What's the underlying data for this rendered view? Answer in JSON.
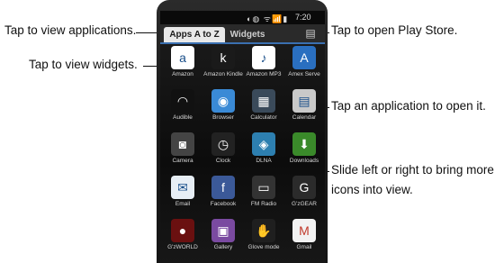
{
  "status_bar": {
    "icons_text": "◐◍ ᯤ📶▮",
    "time": "7:20"
  },
  "tabs": [
    {
      "label": "Apps A to Z"
    },
    {
      "label": "Widgets"
    }
  ],
  "store_icon": "play-store-icon",
  "apps": [
    {
      "label": "Amazon",
      "icon": "amazon-icon",
      "color": "#ffffff"
    },
    {
      "label": "Amazon Kindle",
      "icon": "kindle-icon",
      "color": "#1a1a1a"
    },
    {
      "label": "Amazon MP3",
      "icon": "amazon-mp3-icon",
      "color": "#ffffff"
    },
    {
      "label": "Amex Serve",
      "icon": "amex-icon",
      "color": "#2a6fc0"
    },
    {
      "label": "Audible",
      "icon": "audible-icon",
      "color": "#111111"
    },
    {
      "label": "Browser",
      "icon": "globe-icon",
      "color": "#3a8ad6"
    },
    {
      "label": "Calculator",
      "icon": "calculator-icon",
      "color": "#3a4a5a"
    },
    {
      "label": "Calendar",
      "icon": "calendar-icon",
      "color": "#c9c9c9"
    },
    {
      "label": "Camera",
      "icon": "camera-icon",
      "color": "#444444"
    },
    {
      "label": "Clock",
      "icon": "clock-icon",
      "color": "#222222"
    },
    {
      "label": "DLNA",
      "icon": "dlna-icon",
      "color": "#2d7fb0"
    },
    {
      "label": "Downloads",
      "icon": "download-icon",
      "color": "#3a8a2a"
    },
    {
      "label": "Email",
      "icon": "email-icon",
      "color": "#e7eef5"
    },
    {
      "label": "Facebook",
      "icon": "facebook-icon",
      "color": "#3b5998"
    },
    {
      "label": "FM Radio",
      "icon": "radio-icon",
      "color": "#333333"
    },
    {
      "label": "G'zGEAR",
      "icon": "gzgear-icon",
      "color": "#2b2b2b"
    },
    {
      "label": "G'zWORLD",
      "icon": "gzworld-icon",
      "color": "#6a1010"
    },
    {
      "label": "Gallery",
      "icon": "gallery-icon",
      "color": "#7a4aa0"
    },
    {
      "label": "Glove mode",
      "icon": "glove-icon",
      "color": "#1f1f1f"
    },
    {
      "label": "Gmail",
      "icon": "gmail-icon",
      "color": "#f2f2f2"
    }
  ],
  "callouts": {
    "view_apps": "Tap to view applications.",
    "view_widgets": "Tap to view widgets.",
    "open_store": "Tap to open Play Store.",
    "open_app": "Tap an application to open it.",
    "slide_1": "Slide left or right to bring more",
    "slide_2": "icons into view."
  }
}
